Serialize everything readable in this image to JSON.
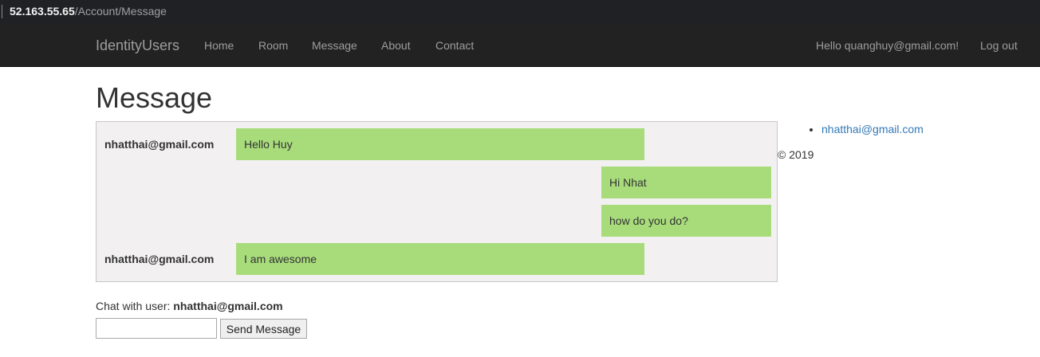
{
  "browser": {
    "url_host": "52.163.55.65",
    "url_path": "/Account/Message"
  },
  "navbar": {
    "brand": "IdentityUsers",
    "links": [
      "Home",
      "Room",
      "Message",
      "About",
      "Contact"
    ],
    "greeting": "Hello quanghuy@gmail.com!",
    "logout": "Log out"
  },
  "page": {
    "title": "Message"
  },
  "messages": [
    {
      "sender": "nhatthai@gmail.com",
      "text": "Hello Huy",
      "direction": "incoming"
    },
    {
      "sender": "",
      "text": "Hi Nhat",
      "direction": "outgoing"
    },
    {
      "sender": "",
      "text": "how do you do?",
      "direction": "outgoing"
    },
    {
      "sender": "nhatthai@gmail.com",
      "text": "I am awesome",
      "direction": "incoming"
    }
  ],
  "users": [
    "nhatthai@gmail.com"
  ],
  "footer": "© 2019",
  "chat": {
    "label": "Chat with user:",
    "user": "nhatthai@gmail.com",
    "input_value": "",
    "send_label": "Send Message"
  },
  "colors": {
    "bubble": "#a8dc7b",
    "chat_bg": "#f2f0f0",
    "navbar": "#222222",
    "link": "#337ab7"
  }
}
